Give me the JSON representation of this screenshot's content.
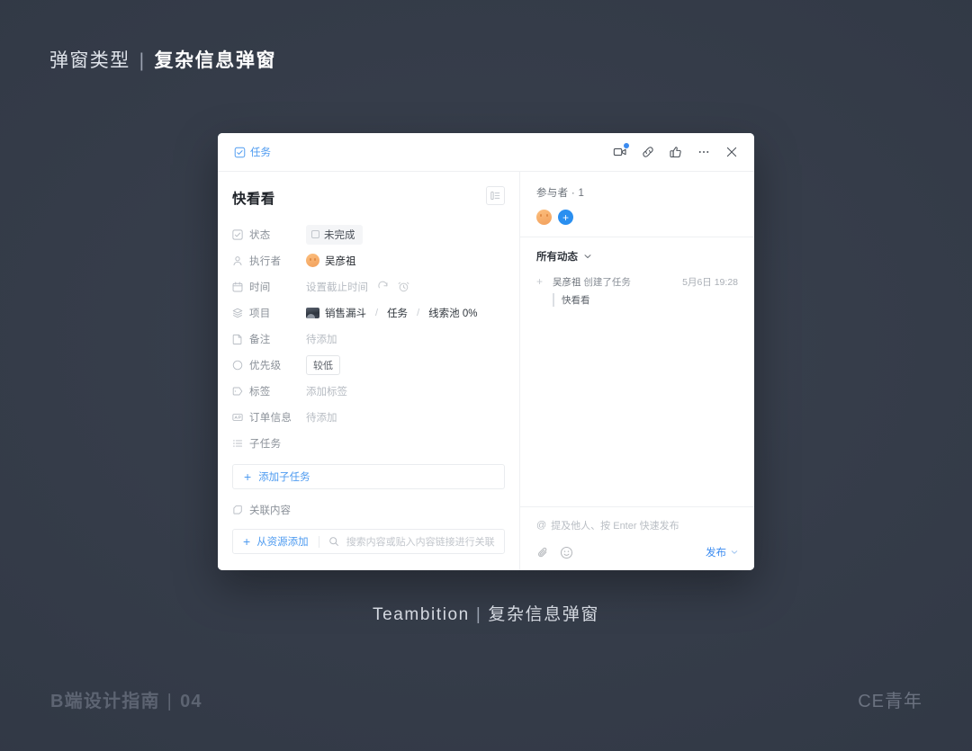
{
  "slide": {
    "title_light": "弹窗类型",
    "title_bar": "|",
    "title_bold": "复杂信息弹窗",
    "caption_left": "Teambition",
    "caption_bar": "|",
    "caption_right": "复杂信息弹窗",
    "footer_left_text": "B端设计指南",
    "footer_left_bar": "|",
    "footer_left_num": "04",
    "footer_right": "CE青年",
    "bg_color": "#363d4a",
    "accent_color": "#3b8bf0"
  },
  "dialog": {
    "header": {
      "type_label": "任务",
      "icons": [
        {
          "name": "meeting-icon",
          "badge": true
        },
        {
          "name": "link-icon",
          "badge": false
        },
        {
          "name": "like-icon",
          "badge": false
        },
        {
          "name": "more-icon",
          "badge": false
        },
        {
          "name": "close-icon",
          "badge": false
        }
      ]
    },
    "left": {
      "task_title": "快看看",
      "layout_toggle": "layout-icon",
      "fields": [
        {
          "icon": "status-icon",
          "label": "状态",
          "value": "未完成",
          "kind": "status-chip"
        },
        {
          "icon": "person-icon",
          "label": "执行者",
          "value": "吴彦祖",
          "kind": "assignee"
        },
        {
          "icon": "calendar-icon",
          "label": "时间",
          "value": "设置截止时间",
          "kind": "date"
        },
        {
          "icon": "project-icon",
          "label": "项目",
          "value": "",
          "kind": "breadcrumb"
        },
        {
          "icon": "note-icon",
          "label": "备注",
          "value": "待添加",
          "kind": "placeholder"
        },
        {
          "icon": "circle-icon",
          "label": "优先级",
          "value": "较低",
          "kind": "priority-chip"
        },
        {
          "icon": "tag-icon",
          "label": "标签",
          "value": "添加标签",
          "kind": "placeholder"
        },
        {
          "icon": "order-icon",
          "label": "订单信息",
          "value": "待添加",
          "kind": "placeholder"
        },
        {
          "icon": "subtask-icon",
          "label": "子任务",
          "value": "",
          "kind": "none"
        }
      ],
      "breadcrumb": [
        "销售漏斗",
        "任务",
        "线索池 0%"
      ],
      "breadcrumb_sep": "/",
      "add_subtask": "添加子任务",
      "related_section": "关联内容",
      "add_from_resource": "从资源添加",
      "resource_placeholder": "搜索内容或贴入内容链接进行关联",
      "plus": "+"
    },
    "right": {
      "participants_title": "参与者 · 1",
      "add_participant": "+",
      "activity_filter": "所有动态",
      "activities": [
        {
          "actor": "吴彦祖",
          "action": "创建了任务",
          "time": "5月6日 19:28",
          "quote": "快看看"
        }
      ],
      "comment_placeholder": "提及他人、按 Enter 快速发布",
      "mention_symbol": "@",
      "publish_label": "发布"
    }
  }
}
